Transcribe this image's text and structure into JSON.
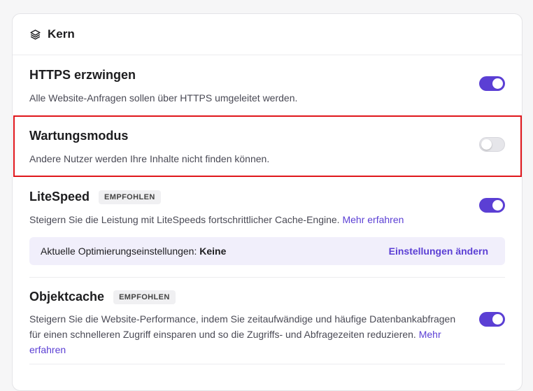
{
  "header": {
    "title": "Kern",
    "icon": "layers-icon"
  },
  "https": {
    "title": "HTTPS erzwingen",
    "description": "Alle Website-Anfragen sollen über HTTPS umgeleitet werden.",
    "enabled": true
  },
  "maintenance": {
    "title": "Wartungsmodus",
    "description": "Andere Nutzer werden Ihre Inhalte nicht finden können.",
    "enabled": false
  },
  "litespeed": {
    "title": "LiteSpeed",
    "badge": "EMPFOHLEN",
    "description": "Steigern Sie die Leistung mit LiteSpeeds fortschrittlicher Cache-Engine.",
    "link": "Mehr erfahren",
    "enabled": true,
    "settings_label": "Aktuelle Optimierungseinstellungen:",
    "settings_value": "Keine",
    "settings_action": "Einstellungen ändern"
  },
  "objectcache": {
    "title": "Objektcache",
    "badge": "EMPFOHLEN",
    "description_line1": "Steigern Sie die Website-Performance, indem Sie zeitaufwändige und häufige Datenbankabfragen",
    "description_line2": "für einen schnelleren Zugriff einsparen und so die Zugriffs- und Abfragezeiten reduzieren.",
    "link_part1": "Mehr",
    "link_part2": "erfahren",
    "enabled": true
  },
  "colors": {
    "accent": "#5b3fd4",
    "highlight": "#e0171c",
    "info_bg": "#f1effb"
  }
}
